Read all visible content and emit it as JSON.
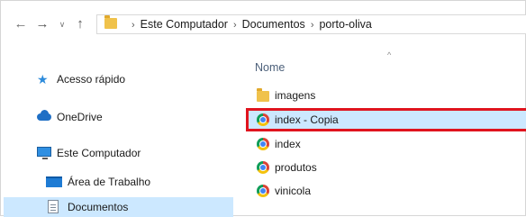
{
  "navigation": {
    "back_glyph": "←",
    "forward_glyph": "→",
    "recent_glyph": "∨",
    "up_glyph": "↑"
  },
  "address_bar": {
    "path": [
      "Este Computador",
      "Documentos",
      "porto-oliva"
    ],
    "separator": "›"
  },
  "sidebar": {
    "items": [
      {
        "label": "Acesso rápido",
        "icon": "star-icon"
      },
      {
        "label": "OneDrive",
        "icon": "cloud-icon"
      },
      {
        "label": "Este Computador",
        "icon": "computer-icon"
      },
      {
        "label": "Área de Trabalho",
        "icon": "desktop-icon"
      },
      {
        "label": "Documentos",
        "icon": "documents-icon",
        "selected": true
      }
    ]
  },
  "file_list": {
    "column_header": "Nome",
    "sort_indicator": "^",
    "items": [
      {
        "name": "imagens",
        "type": "folder",
        "icon": "folder-icon"
      },
      {
        "name": "index - Copia",
        "type": "chrome-html",
        "icon": "chrome-icon",
        "selected": true
      },
      {
        "name": "index",
        "type": "chrome-html",
        "icon": "chrome-icon"
      },
      {
        "name": "produtos",
        "type": "chrome-html",
        "icon": "chrome-icon"
      },
      {
        "name": "vinicola",
        "type": "chrome-html",
        "icon": "chrome-icon"
      }
    ]
  },
  "colors": {
    "selection_background": "#cce8ff",
    "highlight_border": "#e0141e",
    "folder": "#f0c24b",
    "header_text": "#4c607a"
  }
}
